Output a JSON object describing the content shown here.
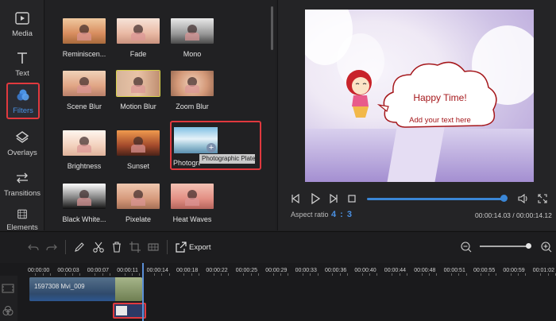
{
  "sidebar": {
    "items": [
      {
        "label": "Media",
        "icon": "play-icon"
      },
      {
        "label": "Text",
        "icon": "text-icon"
      },
      {
        "label": "Filters",
        "icon": "filters-icon",
        "active": true
      },
      {
        "label": "Overlays",
        "icon": "overlays-icon"
      },
      {
        "label": "Transitions",
        "icon": "transitions-icon"
      },
      {
        "label": "Elements",
        "icon": "elements-icon"
      }
    ]
  },
  "filters": {
    "items": [
      {
        "label": "Reminiscen...",
        "tone": "warm-sepia"
      },
      {
        "label": "Fade",
        "tone": "faded"
      },
      {
        "label": "Mono",
        "tone": "mono"
      },
      {
        "label": "Scene Blur",
        "tone": "blur"
      },
      {
        "label": "Motion Blur",
        "tone": "motion-blur",
        "selected": true
      },
      {
        "label": "Zoom Blur",
        "tone": "zoom-blur"
      },
      {
        "label": "Brightness",
        "tone": "bright"
      },
      {
        "label": "Sunset",
        "tone": "sunset"
      },
      {
        "label": "Photograph...",
        "tone": "photographic-plate",
        "hovered": true
      },
      {
        "label": "Black White...",
        "tone": "black-white"
      },
      {
        "label": "Pixelate",
        "tone": "pixelate"
      },
      {
        "label": "Heat Waves",
        "tone": "heat-waves"
      }
    ],
    "tooltip": "Photographic Plate"
  },
  "preview": {
    "caption_main": "Happy Time!",
    "caption_sub": "Add your text here",
    "aspect_ratio_label": "Aspect ratio",
    "aspect_ratio_value": "4 : 3",
    "timecode": "00:00:14.03 / 00:00:14.12",
    "progress": 0.99
  },
  "toolbar": {
    "export_label": "Export",
    "zoom_level": 0.9
  },
  "timeline": {
    "ticks": [
      "00:00:00",
      "00:00:03",
      "00:00:07",
      "00:00:11",
      "00:00:14",
      "00:00:18",
      "00:00:22",
      "00:00:25",
      "00:00:29",
      "00:00:33",
      "00:00:36",
      "00:00:40",
      "00:00:44",
      "00:00:48",
      "00:00:51",
      "00:00:55",
      "00:00:59",
      "00:01:02"
    ],
    "clip_label": "1597308 Mvi_009",
    "colors": {
      "accent": "#3a86d6",
      "highlight": "#e0393e"
    }
  }
}
